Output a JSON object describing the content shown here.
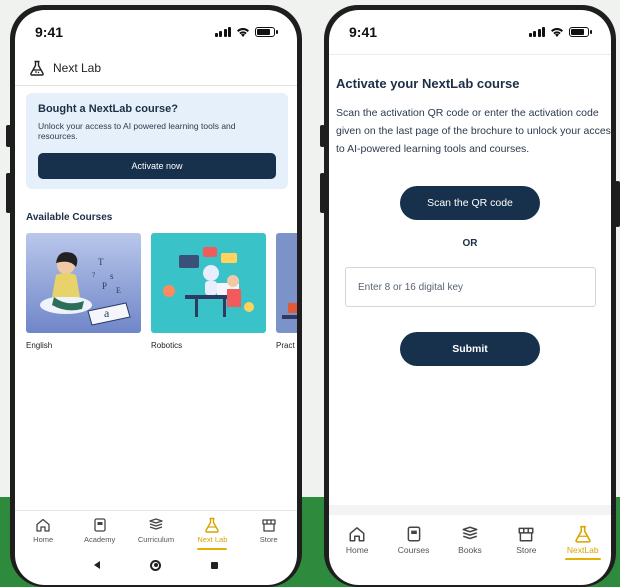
{
  "left_screen": {
    "status_time": "9:41",
    "app_title": "Next Lab",
    "promo": {
      "title": "Bought a NextLab course?",
      "text": "Unlock your access to AI powered learning tools and resources.",
      "button_label": "Activate now"
    },
    "section_title": "Available Courses",
    "courses": [
      {
        "name": "English"
      },
      {
        "name": "Robotics"
      },
      {
        "name": "Pract"
      }
    ],
    "bottom_nav": [
      {
        "label": "Home",
        "icon": "home-icon"
      },
      {
        "label": "Academy",
        "icon": "academy-icon"
      },
      {
        "label": "Curriculum",
        "icon": "books-icon"
      },
      {
        "label": "Next Lab",
        "icon": "flask-icon",
        "active": true
      },
      {
        "label": "Store",
        "icon": "store-icon"
      }
    ]
  },
  "right_screen": {
    "status_time": "9:41",
    "title": "Activate your NextLab course",
    "description": "Scan the activation QR code or enter the activation code given on the last page of the brochure to unlock your access to AI-powered learning tools and courses.",
    "scan_button": "Scan the QR code",
    "or_text": "OR",
    "key_input": {
      "value": "",
      "placeholder": "Enter 8 or 16 digital key"
    },
    "submit_button": "Submit",
    "bottom_nav": [
      {
        "label": "Home",
        "icon": "home-icon"
      },
      {
        "label": "Courses",
        "icon": "courses-icon"
      },
      {
        "label": "Books",
        "icon": "books-icon"
      },
      {
        "label": "Store",
        "icon": "store-icon"
      },
      {
        "label": "NextLab",
        "icon": "flask-icon",
        "active": true
      }
    ]
  },
  "colors": {
    "primary": "#17314d",
    "accent": "#e2b200",
    "promo_bg": "#e5f0fa",
    "band": "#2e8b3e"
  }
}
